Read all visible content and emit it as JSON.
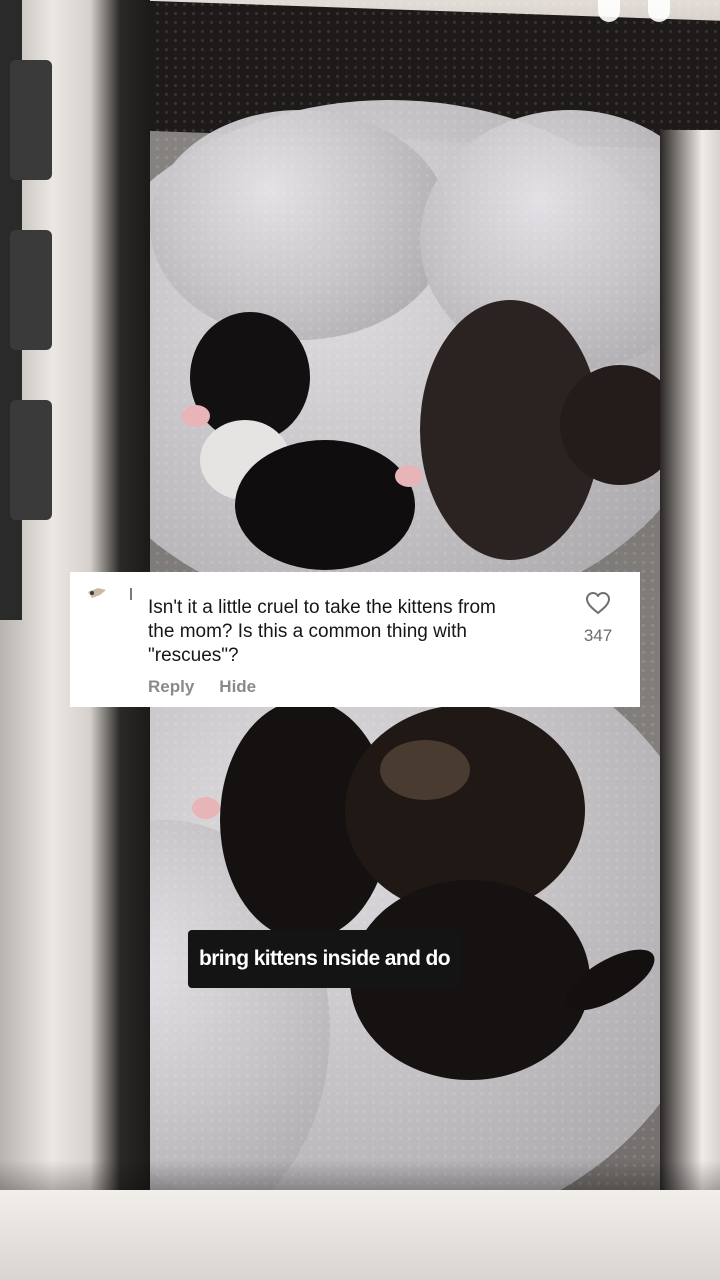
{
  "comment": {
    "text": "Isn't it a little cruel to take the kittens from\nthe mom? Is this a common thing with\n\"rescues\"?",
    "like_count": "347",
    "reply_label": "Reply",
    "hide_label": "Hide",
    "like_icon": "heart-outline-icon"
  },
  "caption": {
    "text": "bring kittens inside and do"
  },
  "colors": {
    "comment_bg": "#ffffff",
    "caption_bg": "#141414",
    "action_text": "#8a8a8a"
  }
}
